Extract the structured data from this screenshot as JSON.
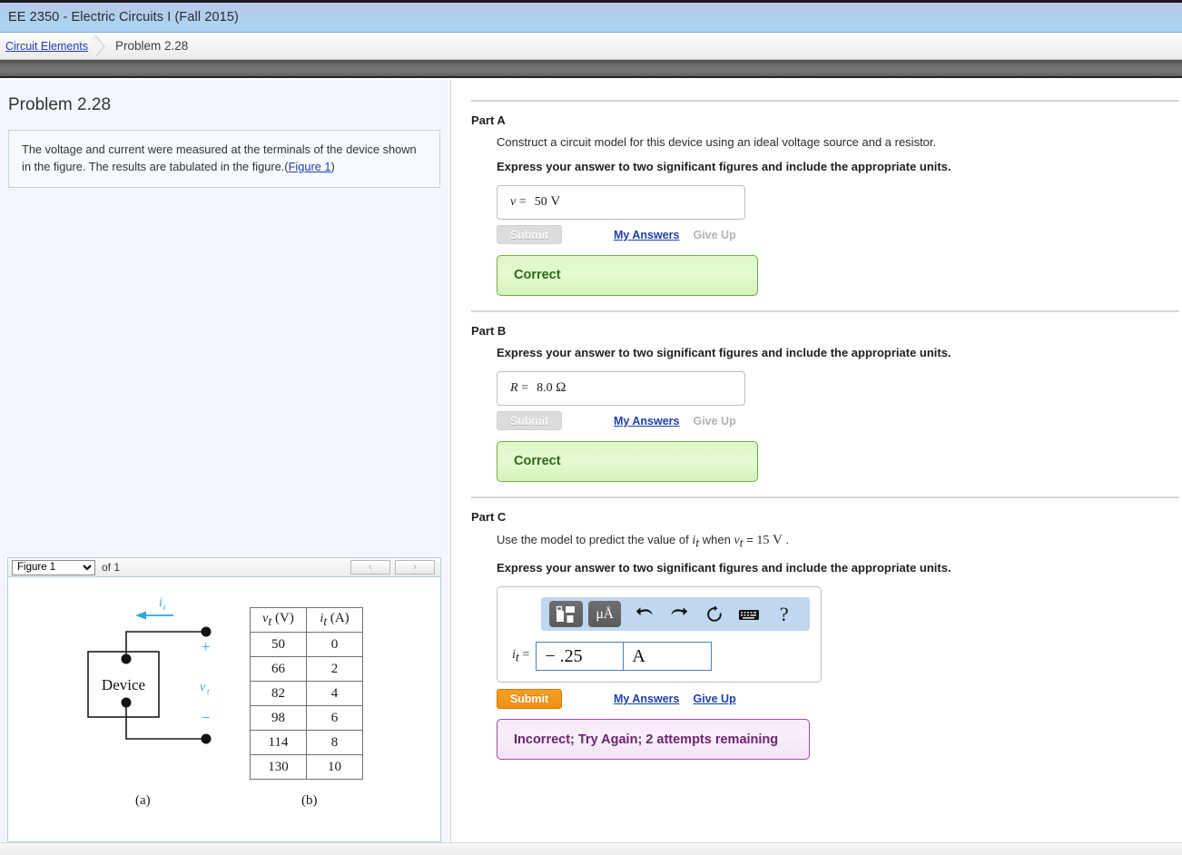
{
  "titlebar": {
    "course": "EE 2350 - Electric Circuits I (Fall 2015)"
  },
  "breadcrumb": {
    "link": "Circuit Elements",
    "current": "Problem 2.28"
  },
  "left": {
    "problem_title": "Problem 2.28",
    "statement_part1": "The voltage and current were measured at the terminals of the device shown in the figure. The results are tabulated in the figure.",
    "statement_open_paren": "(",
    "figure_link": "Figure 1",
    "statement_close_paren": ")"
  },
  "figure_widget": {
    "selected": "Figure 1",
    "options": [
      "Figure 1"
    ],
    "of_label": "of 1",
    "prev_icon": "‹",
    "next_icon": "›",
    "caption_a": "(a)",
    "caption_b": "(b)",
    "device_label": "Device",
    "current_label": "i",
    "current_sub": "t",
    "voltage_label": "v",
    "voltage_sub": "t",
    "plus_sign": "+",
    "minus_sign": "−",
    "accent_color": "#2aa8e0"
  },
  "figure_table": {
    "headers": [
      "v_t (V)",
      "i_t (A)"
    ],
    "header_v_var": "v",
    "header_v_sub": "t",
    "header_v_unit": "(V)",
    "header_i_var": "i",
    "header_i_sub": "t",
    "header_i_unit": "(A)",
    "rows": [
      {
        "v": "50",
        "i": "0"
      },
      {
        "v": "66",
        "i": "2"
      },
      {
        "v": "82",
        "i": "4"
      },
      {
        "v": "98",
        "i": "6"
      },
      {
        "v": "114",
        "i": "8"
      },
      {
        "v": "130",
        "i": "10"
      }
    ]
  },
  "chart_data": {
    "type": "table",
    "title": "Terminal measurements of device",
    "columns": [
      "v_t (V)",
      "i_t (A)"
    ],
    "xlabel": "i_t (A)",
    "ylabel": "v_t (V)",
    "x": [
      0,
      2,
      4,
      6,
      8,
      10
    ],
    "values": [
      50,
      66,
      82,
      98,
      114,
      130
    ],
    "series": [
      {
        "name": "v_t (V)",
        "values": [
          50,
          66,
          82,
          98,
          114,
          130
        ]
      },
      {
        "name": "i_t (A)",
        "values": [
          0,
          2,
          4,
          6,
          8,
          10
        ]
      }
    ]
  },
  "parts": [
    {
      "id": "part-a",
      "heading": "Part A",
      "prompt": "Construct a circuit model for this device using an ideal voltage source and a resistor.",
      "instruction": "Express your answer to two significant figures and include the appropriate units.",
      "answer_var": "v",
      "answer_sub": "",
      "answer_eq": "=",
      "answer_value": "50",
      "answer_unit": "V",
      "submit_label": "Submit",
      "submit_state": "disabled",
      "my_answers_label": "My Answers",
      "give_up_label": "Give Up",
      "give_up_state": "disabled",
      "feedback": "Correct",
      "feedback_type": "correct"
    },
    {
      "id": "part-b",
      "heading": "Part B",
      "prompt": "",
      "instruction": "Express your answer to two significant figures and include the appropriate units.",
      "answer_var": "R",
      "answer_sub": "",
      "answer_eq": "=",
      "answer_value": "8.0",
      "answer_unit": "Ω",
      "submit_label": "Submit",
      "submit_state": "disabled",
      "my_answers_label": "My Answers",
      "give_up_label": "Give Up",
      "give_up_state": "disabled",
      "feedback": "Correct",
      "feedback_type": "correct"
    }
  ],
  "part_c": {
    "heading": "Part C",
    "prompt_pre": "Use the model to predict the value of ",
    "prompt_var1": "i",
    "prompt_var1_sub": "t",
    "prompt_mid": " when ",
    "prompt_var2": "v",
    "prompt_var2_sub": "t",
    "prompt_eq": " = ",
    "prompt_value": "15",
    "prompt_unit": "V",
    "prompt_end": ".",
    "instruction": "Express your answer to two significant figures and include the appropriate units.",
    "toolbar": {
      "template_icon": "template-icon",
      "units_icon_label": "μÅ",
      "undo_icon": "↶",
      "redo_icon": "↷",
      "reset_icon": "↻",
      "keyboard_icon": "⌨",
      "help_icon": "?"
    },
    "answer_var": "i",
    "answer_sub": "t",
    "answer_eq": "=",
    "answer_value": "− .25",
    "answer_unit": "A",
    "submit_label": "Submit",
    "submit_state": "active",
    "my_answers_label": "My Answers",
    "give_up_label": "Give Up",
    "give_up_state": "active",
    "feedback": "Incorrect; Try Again; 2 attempts remaining",
    "feedback_type": "incorrect"
  },
  "colors": {
    "link": "#1d3faf",
    "correct_text": "#2a6b13",
    "incorrect_text": "#6d2470",
    "submit_orange": "#ef8f12",
    "toolbar_blue": "#bfd8ef"
  }
}
